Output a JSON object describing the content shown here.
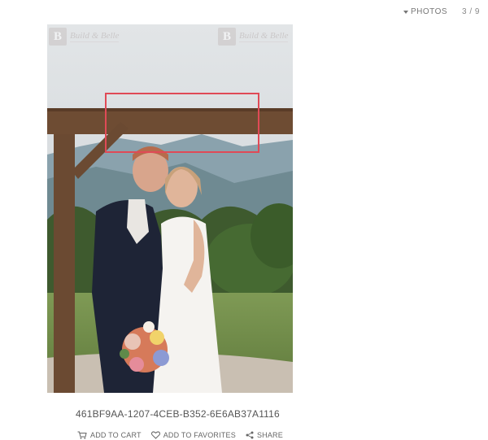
{
  "nav": {
    "photos_label": "PHOTOS",
    "counter": "3 / 9"
  },
  "watermark": {
    "logo_letter": "B",
    "text": "Build & Belle"
  },
  "photo": {
    "filename": "461BF9AA-1207-4CEB-B352-6E6AB37A1116"
  },
  "actions": {
    "add_to_cart": "ADD TO CART",
    "add_to_favorites": "ADD TO FAVORITES",
    "share": "SHARE"
  },
  "colors": {
    "selection_box": "#e04a56"
  }
}
